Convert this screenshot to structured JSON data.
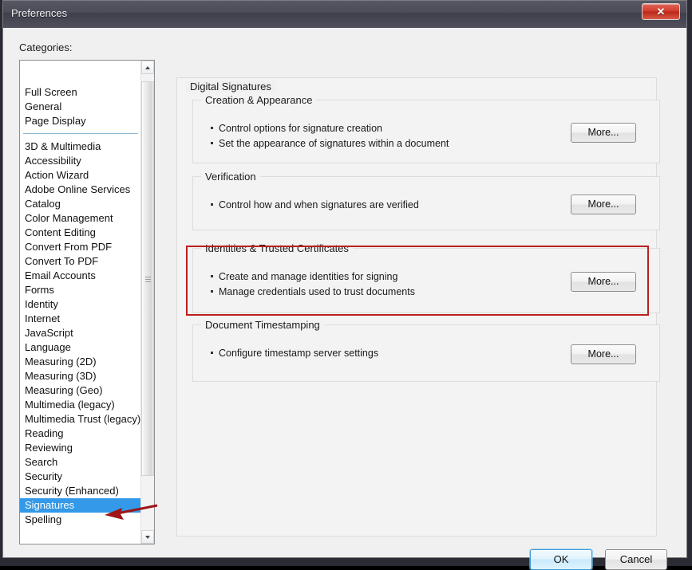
{
  "window": {
    "title": "Preferences",
    "close_label": "✕"
  },
  "sidebar": {
    "label": "Categories:",
    "selected": "Signatures",
    "items": [
      {
        "label": "Full Screen",
        "selected": false
      },
      {
        "label": "General",
        "selected": false
      },
      {
        "label": "Page Display",
        "selected": false
      },
      {
        "separator": true
      },
      {
        "label": "3D & Multimedia",
        "selected": false
      },
      {
        "label": "Accessibility",
        "selected": false
      },
      {
        "label": "Action Wizard",
        "selected": false
      },
      {
        "label": "Adobe Online Services",
        "selected": false
      },
      {
        "label": "Catalog",
        "selected": false
      },
      {
        "label": "Color Management",
        "selected": false
      },
      {
        "label": "Content Editing",
        "selected": false
      },
      {
        "label": "Convert From PDF",
        "selected": false
      },
      {
        "label": "Convert To PDF",
        "selected": false
      },
      {
        "label": "Email Accounts",
        "selected": false
      },
      {
        "label": "Forms",
        "selected": false
      },
      {
        "label": "Identity",
        "selected": false
      },
      {
        "label": "Internet",
        "selected": false
      },
      {
        "label": "JavaScript",
        "selected": false
      },
      {
        "label": "Language",
        "selected": false
      },
      {
        "label": "Measuring (2D)",
        "selected": false
      },
      {
        "label": "Measuring (3D)",
        "selected": false
      },
      {
        "label": "Measuring (Geo)",
        "selected": false
      },
      {
        "label": "Multimedia (legacy)",
        "selected": false
      },
      {
        "label": "Multimedia Trust (legacy)",
        "selected": false
      },
      {
        "label": "Reading",
        "selected": false
      },
      {
        "label": "Reviewing",
        "selected": false
      },
      {
        "label": "Search",
        "selected": false
      },
      {
        "label": "Security",
        "selected": false
      },
      {
        "label": "Security (Enhanced)",
        "selected": false
      },
      {
        "label": "Signatures",
        "selected": true
      },
      {
        "label": "Spelling",
        "selected": false
      }
    ],
    "scrollbar": {
      "up_icon": "chevron-up-icon",
      "down_icon": "chevron-down-icon"
    }
  },
  "main": {
    "title": "Digital Signatures",
    "groups": [
      {
        "legend": "Creation & Appearance",
        "bullets": [
          "Control options for signature creation",
          "Set the appearance of signatures within a document"
        ],
        "button": "More..."
      },
      {
        "legend": "Verification",
        "bullets": [
          "Control how and when signatures are verified"
        ],
        "button": "More..."
      },
      {
        "legend": "Identities & Trusted Certificates",
        "bullets": [
          "Create and manage identities for signing",
          "Manage credentials used to trust documents"
        ],
        "button": "More..."
      },
      {
        "legend": "Document Timestamping",
        "bullets": [
          "Configure timestamp server settings"
        ],
        "button": "More..."
      }
    ]
  },
  "footer": {
    "ok_label": "OK",
    "cancel_label": "Cancel"
  },
  "annotations": {
    "highlight_color": "#bb1f1f",
    "arrow_color": "#9e1515",
    "selection_color": "#3399e8"
  }
}
